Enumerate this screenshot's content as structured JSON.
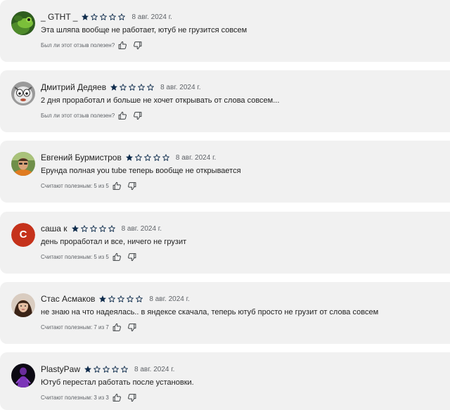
{
  "accent": "#0f2c4c",
  "reviews": [
    {
      "author": "_ GTHT _",
      "avatar": "frog-avatar-icon",
      "rating": 1,
      "date": "8 авг. 2024 г.",
      "text": "Эта шляпа вообще не работает, ютуб не грузится совсем",
      "helpful": "Был ли этот отзыв полезен?"
    },
    {
      "author": "Дмитрий Дедяев",
      "avatar": "cartoon-face-avatar-icon",
      "rating": 1,
      "date": "8 авг. 2024 г.",
      "text": "2 дня проработал и больше не хочет открывать от слова совсем...",
      "helpful": "Был ли этот отзыв полезен?"
    },
    {
      "author": "Евгений Бурмистров",
      "avatar": "man-photo-avatar-icon",
      "rating": 1,
      "date": "8 авг. 2024 г.",
      "text": "Ерунда полная you tube теперь вообще не открывается",
      "helpful": "Считают полезным: 5 из 5"
    },
    {
      "author": "саша к",
      "avatar_letter": "С",
      "avatar_color": "#c5321b",
      "rating": 1,
      "date": "8 авг. 2024 г.",
      "text": "день проработал и все, ничего не грузит",
      "helpful": "Считают полезным: 5 из 5"
    },
    {
      "author": "Стас Асмаков",
      "avatar": "woman-photo-avatar-icon",
      "rating": 1,
      "date": "8 авг. 2024 г.",
      "text": "не знаю на что надеялась.. в яндексе скачала, теперь ютуб просто не грузит от слова совсем",
      "helpful": "Считают полезным: 7 из 7"
    },
    {
      "author": "PlastyPaw",
      "avatar": "purple-figure-avatar-icon",
      "rating": 1,
      "date": "8 авг. 2024 г.",
      "text": "Ютуб перестал работать после установки.",
      "helpful": "Считают полезным: 3 из 3"
    }
  ]
}
